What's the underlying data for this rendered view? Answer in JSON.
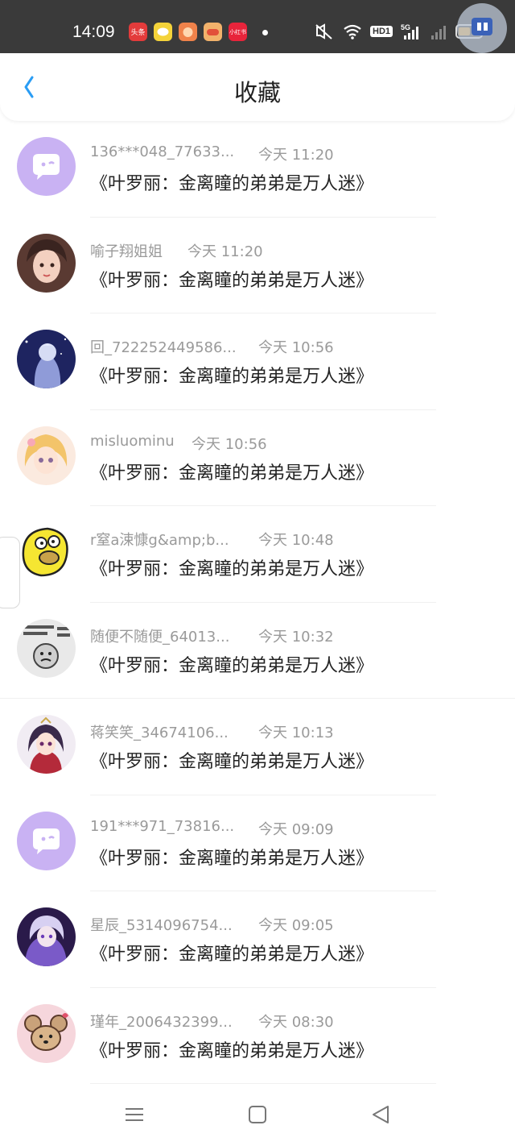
{
  "status_bar": {
    "time": "14:09",
    "apps": [
      {
        "icon": "toutiao-app-icon",
        "label": "头条",
        "color": "#e33b3b"
      },
      {
        "icon": "chat-app-icon",
        "label": "",
        "color": "#f4d33a"
      },
      {
        "icon": "game-app-icon",
        "label": "",
        "color": "#f0824a"
      },
      {
        "icon": "controller-app-icon",
        "label": "",
        "color": "#f2b26b"
      },
      {
        "icon": "xiaohongshu-app-icon",
        "label": "小红书",
        "color": "#e8243b"
      }
    ],
    "network": "5G",
    "hd_label": "HD1"
  },
  "header": {
    "title": "收藏",
    "accent_color": "#2a9df4"
  },
  "favorites": [
    {
      "name": "136***048_77633...",
      "time": "今天 11:20",
      "content": "《叶罗丽：金离瞳的弟弟是万人迷》",
      "avatar": "default-chat-avatar"
    },
    {
      "name": "喻子翔姐姐",
      "time": "今天 11:20",
      "content": "《叶罗丽：金离瞳的弟弟是万人迷》",
      "avatar": "girl-portrait-avatar"
    },
    {
      "name": "回_722252449586...",
      "time": "今天 10:56",
      "content": "《叶罗丽：金离瞳的弟弟是万人迷》",
      "avatar": "anime-night-avatar"
    },
    {
      "name": "misluominu",
      "time": "今天 10:56",
      "content": "《叶罗丽：金离瞳的弟弟是万人迷》",
      "avatar": "anime-blonde-avatar"
    },
    {
      "name": "r窒a涑慷g&amp;b...",
      "time": "今天 10:48",
      "content": "《叶罗丽：金离瞳的弟弟是万人迷》",
      "avatar": "cartoon-yellow-avatar"
    },
    {
      "name": "随便不随便_64013...",
      "time": "今天 10:32",
      "content": "《叶罗丽：金离瞳的弟弟是万人迷》",
      "avatar": "meme-text-avatar"
    },
    {
      "name": "蒋笑笑_34674106...",
      "time": "今天 10:13",
      "content": "《叶罗丽：金离瞳的弟弟是万人迷》",
      "avatar": "anime-costume-avatar"
    },
    {
      "name": "191***971_73816...",
      "time": "今天 09:09",
      "content": "《叶罗丽：金离瞳的弟弟是万人迷》",
      "avatar": "default-chat-avatar"
    },
    {
      "name": "星辰_5314096754...",
      "time": "今天 09:05",
      "content": "《叶罗丽：金离瞳的弟弟是万人迷》",
      "avatar": "anime-purple-avatar"
    },
    {
      "name": "瑾年_2006432399...",
      "time": "今天 08:30",
      "content": "《叶罗丽：金离瞳的弟弟是万人迷》",
      "avatar": "cartoon-mouse-avatar"
    }
  ],
  "nav": {
    "icons": [
      "menu-icon",
      "home-square-icon",
      "back-triangle-icon"
    ]
  }
}
